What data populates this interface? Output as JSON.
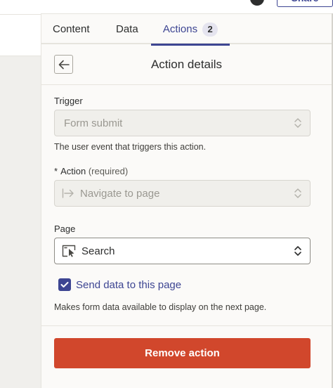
{
  "header": {
    "share_label": "Share"
  },
  "tabs": [
    {
      "label": "Content"
    },
    {
      "label": "Data"
    },
    {
      "label": "Actions",
      "badge": "2",
      "active": true
    }
  ],
  "action_panel": {
    "title": "Action details",
    "trigger": {
      "label": "Trigger",
      "value": "Form submit",
      "help": "The user event that triggers this action."
    },
    "action": {
      "required_marker": "*",
      "label": "Action",
      "required_note": "(required)",
      "value": "Navigate to page"
    },
    "page": {
      "label": "Page",
      "value": "Search"
    },
    "send_data": {
      "checked": true,
      "label": "Send data to this page",
      "help": "Makes form data available to display on the next page."
    },
    "remove_label": "Remove action"
  },
  "colors": {
    "accent": "#3d4592",
    "danger": "#d1472c",
    "panel_bg": "#fbfaf8"
  },
  "icons": {
    "back": "arrow-left-icon",
    "action_leading": "arrow-to-line-icon",
    "page_leading": "page-cursor-icon",
    "select_chevrons": "chevron-up-down-icon",
    "checkbox": "checkmark-icon"
  }
}
